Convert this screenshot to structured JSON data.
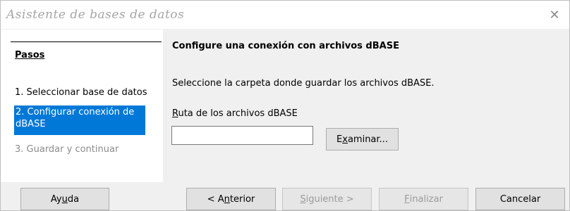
{
  "window": {
    "title": "Asistente de bases de datos",
    "close_icon": "close-icon"
  },
  "sidebar": {
    "title": "Pasos",
    "steps": [
      {
        "label": "1. Seleccionar base de datos",
        "state": "done"
      },
      {
        "label": "2. Configurar conexión de dBASE",
        "state": "current"
      },
      {
        "label": "3. Guardar y continuar",
        "state": "disabled"
      }
    ]
  },
  "main": {
    "heading": "Configure una conexión con archivos dBASE",
    "description": "Seleccione la carpeta donde guardar los archivos dBASE.",
    "path_label_mnemonic": "R",
    "path_label_rest": "uta de los archivos dBASE",
    "path_value": "",
    "browse": {
      "pre": "E",
      "mnemonic": "x",
      "post": "aminar..."
    }
  },
  "buttons": {
    "help": {
      "pre": "Ay",
      "mnemonic": "u",
      "post": "da"
    },
    "back": {
      "pre": "< A",
      "mnemonic": "n",
      "post": "terior"
    },
    "next": {
      "pre": "",
      "mnemonic": "S",
      "post": "iguiente >"
    },
    "finish": {
      "pre": "",
      "mnemonic": "F",
      "post": "inalizar"
    },
    "cancel": "Cancelar"
  },
  "colors": {
    "selection": "#0078d7",
    "disabled_text": "#9b9b9b"
  }
}
